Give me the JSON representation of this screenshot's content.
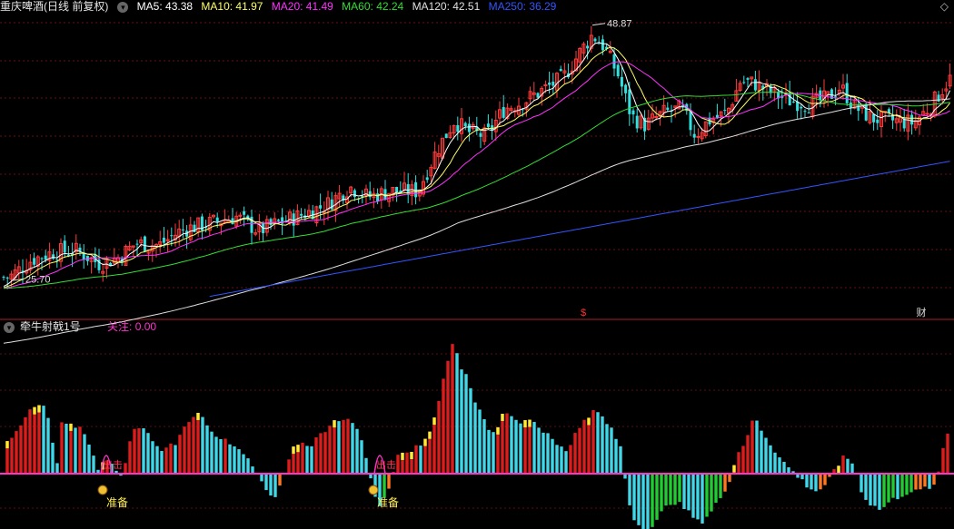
{
  "main_header": {
    "title": "重庆啤酒(日线 前复权)",
    "ma5": "MA5: 43.38",
    "ma10": "MA10: 41.97",
    "ma20": "MA20: 41.49",
    "ma60": "MA60: 42.24",
    "ma120": "MA120: 42.51",
    "ma250": "MA250: 36.29"
  },
  "sub_header": {
    "title": "牵牛射戟1号",
    "focus": "关注: 0.00"
  },
  "top_right_icon": "◇",
  "colors": {
    "up": "#ff3b3b",
    "down": "#33e0e0",
    "ma5": "#ffffff",
    "ma10": "#ffff66",
    "ma20": "#ff33ff",
    "ma60": "#33dd33",
    "ma120": "#e0e0e0",
    "ma250": "#3355ff",
    "hist_red": "#dd1c1c",
    "hist_cyan": "#40d8e8",
    "hist_green": "#22cc33",
    "hist_orange": "#ff7722",
    "hist_yellow": "#ffee33",
    "baseline": "#ff33cc"
  },
  "chart_data": [
    {
      "type": "line",
      "title": "重庆啤酒(日线 前复权)",
      "xlabel": "",
      "ylabel": "",
      "ylim": [
        24,
        50
      ],
      "annotations": [
        {
          "label": "48.87",
          "kind": "high",
          "x": 652,
          "value": 48.87
        },
        {
          "label": "25.70",
          "kind": "low",
          "x": 12,
          "value": 25.7
        }
      ],
      "markers": [
        {
          "label": "$",
          "x": 642
        },
        {
          "label": "财",
          "x": 1014
        }
      ],
      "price_anchors": [
        [
          10,
          26.0
        ],
        [
          35,
          27.6
        ],
        [
          60,
          28.3
        ],
        [
          85,
          28.4
        ],
        [
          110,
          27.2
        ],
        [
          130,
          27.8
        ],
        [
          150,
          29.1
        ],
        [
          175,
          28.9
        ],
        [
          200,
          30.3
        ],
        [
          230,
          30.9
        ],
        [
          260,
          31.5
        ],
        [
          285,
          30.2
        ],
        [
          305,
          30.9
        ],
        [
          330,
          31.6
        ],
        [
          360,
          32.6
        ],
        [
          385,
          34.2
        ],
        [
          405,
          33.3
        ],
        [
          430,
          33.8
        ],
        [
          460,
          33.8
        ],
        [
          480,
          37.4
        ],
        [
          500,
          40.2
        ],
        [
          515,
          39.2
        ],
        [
          535,
          38.8
        ],
        [
          555,
          41.3
        ],
        [
          575,
          41.9
        ],
        [
          600,
          43.1
        ],
        [
          620,
          44.1
        ],
        [
          640,
          46.6
        ],
        [
          652,
          48.0
        ],
        [
          665,
          46.9
        ],
        [
          680,
          44.4
        ],
        [
          695,
          40.6
        ],
        [
          710,
          39.8
        ],
        [
          730,
          40.9
        ],
        [
          750,
          41.3
        ],
        [
          765,
          38.9
        ],
        [
          780,
          40.2
        ],
        [
          800,
          40.9
        ],
        [
          815,
          43.8
        ],
        [
          830,
          43.6
        ],
        [
          850,
          42.7
        ],
        [
          870,
          42.0
        ],
        [
          890,
          41.7
        ],
        [
          910,
          42.2
        ],
        [
          925,
          43.3
        ],
        [
          940,
          41.5
        ],
        [
          960,
          40.4
        ],
        [
          985,
          40.2
        ],
        [
          1005,
          40.0
        ],
        [
          1025,
          41.6
        ],
        [
          1045,
          44.0
        ]
      ],
      "ma_params": [
        {
          "name": "MA5",
          "period": 5,
          "start": 0
        },
        {
          "name": "MA10",
          "period": 10,
          "start": 0
        },
        {
          "name": "MA20",
          "period": 20,
          "start": 0
        },
        {
          "name": "MA60",
          "period": 60,
          "start": 0
        },
        {
          "name": "MA120",
          "period": 120,
          "start": 0
        },
        {
          "name": "MA250",
          "period": 250,
          "start": 230
        }
      ]
    },
    {
      "type": "bar",
      "title": "牵牛射戟1号",
      "ylim": [
        -60,
        150
      ],
      "hist_anchors": [
        [
          12,
          35
        ],
        [
          25,
          55
        ],
        [
          35,
          75
        ],
        [
          45,
          78
        ],
        [
          55,
          60
        ],
        [
          62,
          5
        ],
        [
          68,
          55
        ],
        [
          78,
          55
        ],
        [
          88,
          50
        ],
        [
          98,
          35
        ],
        [
          108,
          5
        ],
        [
          115,
          15
        ],
        [
          125,
          10
        ],
        [
          135,
          -5
        ],
        [
          145,
          45
        ],
        [
          155,
          55
        ],
        [
          165,
          40
        ],
        [
          175,
          25
        ],
        [
          185,
          30
        ],
        [
          195,
          35
        ],
        [
          205,
          55
        ],
        [
          215,
          68
        ],
        [
          225,
          60
        ],
        [
          235,
          45
        ],
        [
          245,
          38
        ],
        [
          255,
          30
        ],
        [
          265,
          25
        ],
        [
          280,
          5
        ],
        [
          290,
          -15
        ],
        [
          300,
          -30
        ],
        [
          310,
          -10
        ],
        [
          320,
          25
        ],
        [
          330,
          35
        ],
        [
          340,
          30
        ],
        [
          350,
          40
        ],
        [
          360,
          50
        ],
        [
          370,
          58
        ],
        [
          380,
          62
        ],
        [
          390,
          58
        ],
        [
          400,
          35
        ],
        [
          405,
          10
        ],
        [
          410,
          -20
        ],
        [
          418,
          -35
        ],
        [
          428,
          -15
        ],
        [
          438,
          20
        ],
        [
          450,
          25
        ],
        [
          460,
          30
        ],
        [
          470,
          40
        ],
        [
          480,
          70
        ],
        [
          490,
          110
        ],
        [
          500,
          148
        ],
        [
          508,
          115
        ],
        [
          515,
          105
        ],
        [
          525,
          75
        ],
        [
          535,
          55
        ],
        [
          545,
          40
        ],
        [
          555,
          70
        ],
        [
          565,
          65
        ],
        [
          575,
          55
        ],
        [
          585,
          60
        ],
        [
          595,
          50
        ],
        [
          605,
          40
        ],
        [
          615,
          30
        ],
        [
          625,
          25
        ],
        [
          635,
          50
        ],
        [
          645,
          60
        ],
        [
          655,
          70
        ],
        [
          665,
          60
        ],
        [
          675,
          45
        ],
        [
          685,
          25
        ],
        [
          690,
          -25
        ],
        [
          700,
          -55
        ],
        [
          710,
          -60
        ],
        [
          720,
          -58
        ],
        [
          730,
          -40
        ],
        [
          740,
          -30
        ],
        [
          750,
          -35
        ],
        [
          760,
          -45
        ],
        [
          770,
          -55
        ],
        [
          780,
          -45
        ],
        [
          790,
          -30
        ],
        [
          800,
          -20
        ],
        [
          810,
          20
        ],
        [
          820,
          35
        ],
        [
          830,
          65
        ],
        [
          840,
          45
        ],
        [
          850,
          30
        ],
        [
          860,
          15
        ],
        [
          870,
          5
        ],
        [
          880,
          -5
        ],
        [
          890,
          -15
        ],
        [
          900,
          -20
        ],
        [
          910,
          -10
        ],
        [
          920,
          5
        ],
        [
          930,
          20
        ],
        [
          940,
          10
        ],
        [
          950,
          -25
        ],
        [
          960,
          -35
        ],
        [
          970,
          -40
        ],
        [
          980,
          -30
        ],
        [
          990,
          -25
        ],
        [
          1000,
          -20
        ],
        [
          1010,
          -20
        ],
        [
          1020,
          -15
        ],
        [
          1030,
          -15
        ],
        [
          1040,
          40
        ],
        [
          1047,
          55
        ]
      ],
      "signals": [
        {
          "label": "准备",
          "x": 113,
          "icon": "money-bag-icon"
        },
        {
          "label": "准备",
          "x": 411,
          "icon": "money-bag-icon"
        },
        {
          "label": "出击",
          "x": 117
        },
        {
          "label": "出击",
          "x": 418
        }
      ]
    }
  ]
}
